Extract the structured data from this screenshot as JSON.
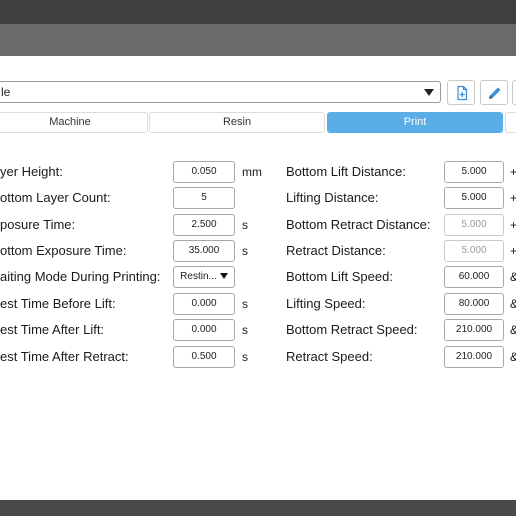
{
  "profile": {
    "value": "le"
  },
  "tabs": [
    {
      "label": "Machine",
      "active": false
    },
    {
      "label": "Resin",
      "active": false
    },
    {
      "label": "Print",
      "active": true
    }
  ],
  "left_fields": [
    {
      "label": "yer Height:",
      "value": "0.050",
      "unit": "mm"
    },
    {
      "label": "ottom Layer Count:",
      "value": "5",
      "unit": ""
    },
    {
      "label": "posure Time:",
      "value": "2.500",
      "unit": "s"
    },
    {
      "label": "ottom Exposure Time:",
      "value": "35.000",
      "unit": "s"
    },
    {
      "label": "aiting Mode During Printing:",
      "value": "Restin...",
      "unit": ""
    },
    {
      "label": "est Time Before Lift:",
      "value": "0.000",
      "unit": "s"
    },
    {
      "label": "est Time After Lift:",
      "value": "0.000",
      "unit": "s"
    },
    {
      "label": "est Time After Retract:",
      "value": "0.500",
      "unit": "s"
    }
  ],
  "right_fields": [
    {
      "label": "Bottom Lift Distance:",
      "value": "5.000",
      "unit": "+"
    },
    {
      "label": "Lifting Distance:",
      "value": "5.000",
      "unit": "+"
    },
    {
      "label": "Bottom Retract Distance:",
      "value": "5.000",
      "unit": "+"
    },
    {
      "label": "Retract Distance:",
      "value": "5.000",
      "unit": "+"
    },
    {
      "label": "Bottom Lift Speed:",
      "value": "60.000",
      "unit": "&"
    },
    {
      "label": "Lifting Speed:",
      "value": "80.000",
      "unit": "&"
    },
    {
      "label": "Bottom Retract Speed:",
      "value": "210.000",
      "unit": "&"
    },
    {
      "label": "Retract Speed:",
      "value": "210.000",
      "unit": "&"
    }
  ],
  "icons": [
    "add-file-icon",
    "pencil-icon"
  ],
  "colors": {
    "accent": "#5aaee8",
    "pencil": "#3a8fd6"
  }
}
